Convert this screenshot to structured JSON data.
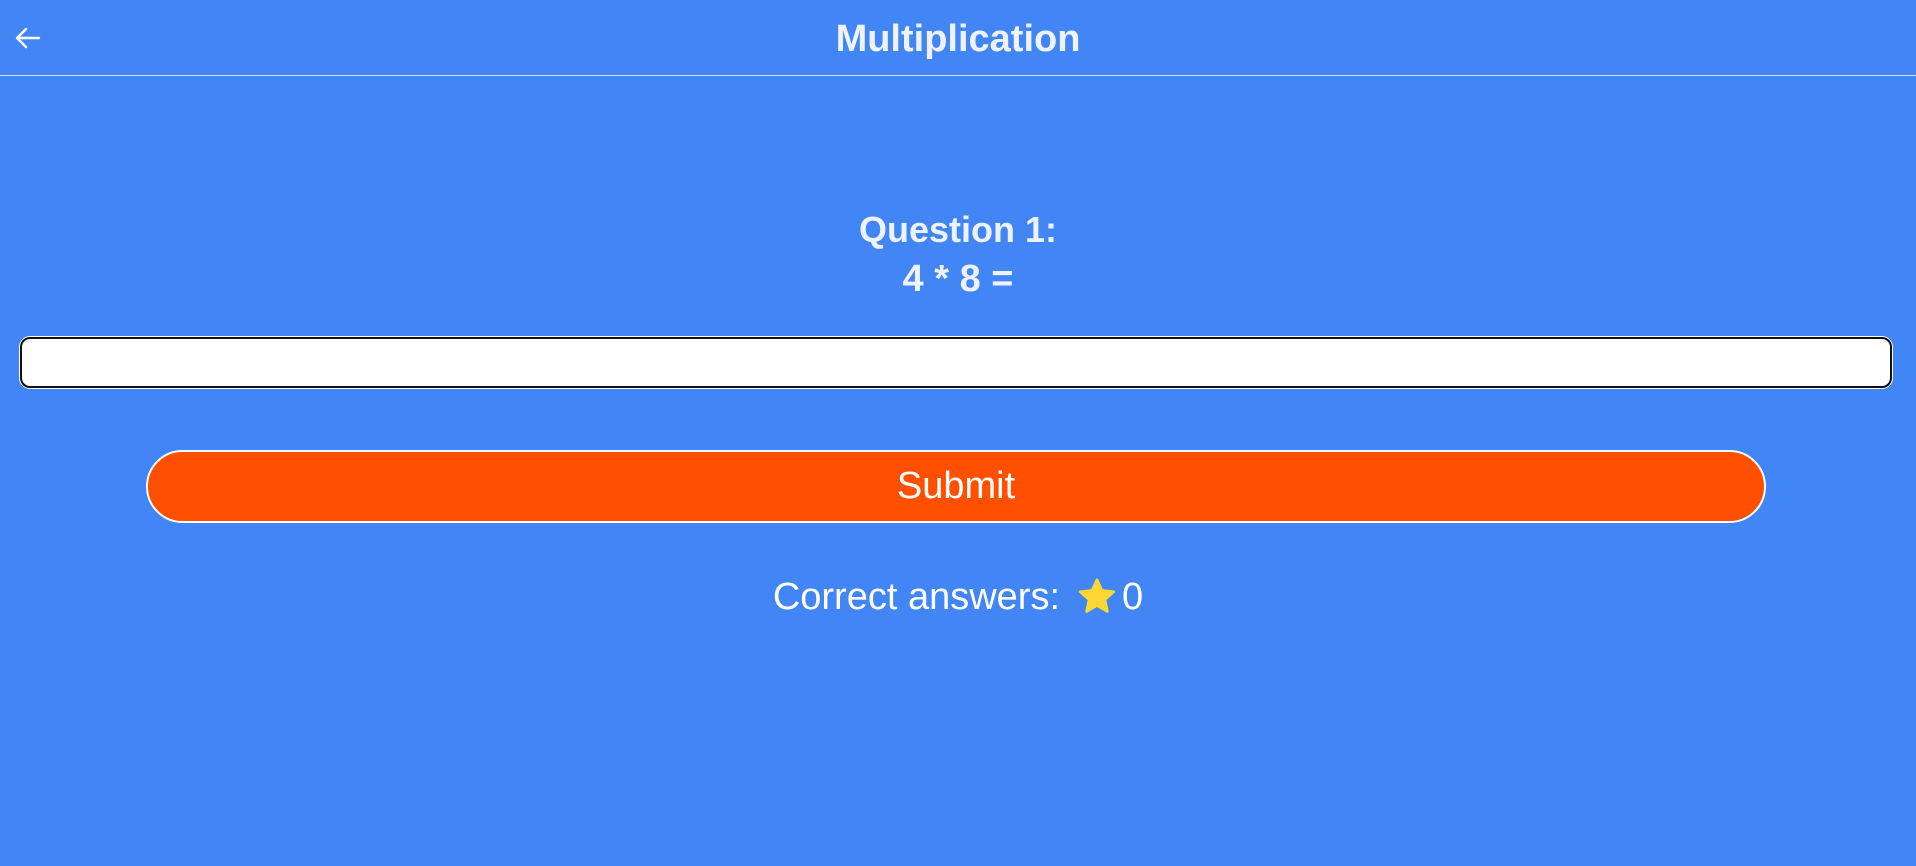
{
  "header": {
    "title": "Multiplication",
    "back_icon": "arrow-left-icon"
  },
  "question": {
    "label": "Question 1:",
    "expression": "4 * 8 ="
  },
  "answer_input": {
    "value": "",
    "placeholder": ""
  },
  "submit": {
    "label": "Submit"
  },
  "score": {
    "label": "Correct answers:",
    "icon": "star-icon",
    "count": "0"
  },
  "colors": {
    "background": "#4285f4",
    "submit_button": "#ff4f00",
    "star": "#fdd835"
  }
}
